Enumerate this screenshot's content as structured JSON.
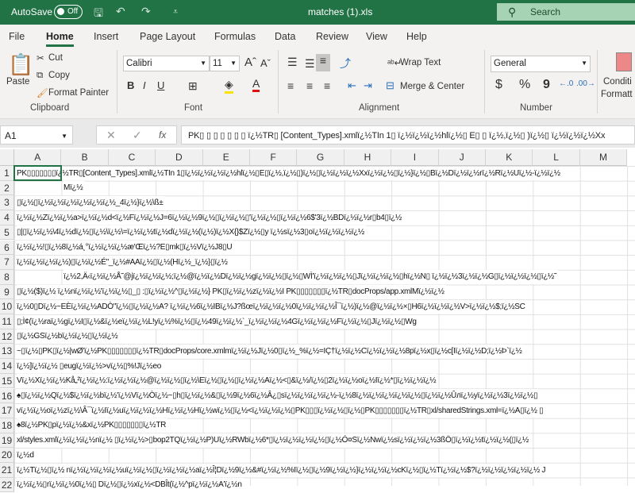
{
  "titlebar": {
    "autosave": "AutoSave",
    "toggle": "Off",
    "filename": "matches (1).xls",
    "search": "Search"
  },
  "tabs": [
    "File",
    "Home",
    "Insert",
    "Page Layout",
    "Formulas",
    "Data",
    "Review",
    "View",
    "Help"
  ],
  "ribbon": {
    "paste": "Paste",
    "cut": "Cut",
    "copy": "Copy",
    "format_painter": "Format Painter",
    "clipboard": "Clipboard",
    "font_name": "Calibri",
    "font_size": "11",
    "bold": "B",
    "italic": "I",
    "underline": "U",
    "font": "Font",
    "wrap_text": "Wrap Text",
    "merge_center": "Merge & Center",
    "alignment": "Alignment",
    "number_format": "General",
    "currency": "$",
    "percent": "%",
    "comma": "9",
    "number": "Number",
    "conditional": "Conditi",
    "formatting": "Formatt"
  },
  "formula_bar": {
    "name_box": "A1",
    "fx": "fx",
    "content": "PK▯ ▯ ▯ ▯ ▯ ▯ ▯ ï¿½TR▯ [Content_Types].xmlï¿½TIn  1▯ ï¿½ï¿½ï¿½hlï¿½▯ E▯ ▯ ï¿½,ï¿½▯ )ï¿½▯ ï¿½ï¿½ï¿½Xx"
  },
  "columns": [
    "A",
    "B",
    "C",
    "D",
    "E",
    "F",
    "G",
    "H",
    "I",
    "J",
    "K",
    "L",
    "M"
  ],
  "rows": [
    {
      "n": "1",
      "text": "PK▯▯▯▯▯▯▯ï¿½TR▯[Content_Types].xmlï¿½TIn  1▯ï¿½ï¿½ï¿½ï¿½hlï¿½▯E▯ï¿½,ï¿½▯)ï¿½▯ï¿½ï¿½ï¿½Xxï¿½ï¿½▯ï¿½}ï¿½▯Bï¿½Dï¿½ï¿½rï¿½Rï¿½Uï¿½-ï¿½ï¿½"
    },
    {
      "n": "2",
      "text": "Mï¿½"
    },
    {
      "n": "3",
      "text": "▯ï¿½▯ï¿½ï¿½ï¿½ï¿½ï¿½ï¿½_4ï¿½}ï¿½\\ß±"
    },
    {
      "n": "4",
      "text": "ï¿½ï¿½Zï¿½ï¿½a>ï¿½ï¿½d<ï¿½Fï¿½ï¿½J=6ï¿½ï¿½9ï¿½▯ï¿½ï¿½▯'ï¿½ï¿½▯ï¿½ï¿½6$'3ï¿½BDï¿½ï¿½r▯b4▯ï¿½"
    },
    {
      "n": "5",
      "text": "▯|▯ï¿½ï¿½\\4ï¿½dï¿½▯ï¿½\\ï¿½\\=ï¿½ï¿½tï¿½dï¿½ï¿½(ï¿½)ï¿½X{}$Zï¿½▯y  ï¿½sï¿½3▯oï¿½ï¿½ï¿½ï¿½"
    },
    {
      "n": "6",
      "text": "ï¿½ï¿½!▯ï¿½8ï¿½á¸°ï¿½ï¿½ï¿½æ'Œï¿½?E▯mk▯ï¿½Vï¿½J8▯U"
    },
    {
      "n": "7",
      "text": "ï¿½ï¿½ï¿½ï¿½)▯ï¿½ï¿½É\"_ï¿½#AAï¿½▯ï¿½(Hï¿½_ï¿½}▯ï¿½"
    },
    {
      "n": "8",
      "text": "ï¿½2,Ä‹ï¿½ï¿½Å˜@jï¿½ï¿½ï¿½;ï¿½@ï¿½ï¿½Dï¿½ï¿½gï¿½ï¿½▯ï¿½▯WÌ'ï¿½ï¿½ï¿½▯Jï¿½ï¿½ï¿½▯hï¿½N▯  ï¿½ï¿½3ï¿½ï¿½G▯ï¿½ï¿½ï¿½▯ï¿½˜"
    },
    {
      "n": "9",
      "text": "▯ï¿½($)ï¿½ ï¿½nï¿½ï¿½'ï¿½ï¿½▯_▯ :▯ï¿½ï¿½^▯ï¿½ï¿½}  PK▯ï¿½ï¿½zï¿½ï¿½I  PK▯▯▯▯▯▯▯ï¿½TR▯docProps/app.xmlMï¿½ï¿½"
    },
    {
      "n": "10",
      "text": "ï¿½0▯Dï¿½~EÈï¿½ï¿½ADÒ\"ï¿½▯ï¿½ï¿½A? ï¿½ï¿½6ï¿½IBï¿½J?ßœï¿½ï¿½ï¿½0ï¿½ï¿½ï¿½Î¯ï¿½)ï¿½@ï¿½ï¿½×▯H6ï¿½ï¿½ï¿½V>ï¿½ï¿½$;ï¿½SC"
    },
    {
      "n": "11",
      "text": "▯;Ì¢(ï¿½raï¿½gï¿½I▯ï¿½&ï¿½eï¿½ï¿½L!yï¿½%ï¿½▯ï¿½49ï¿½ï¿½`_ï¿½ï¿½ï¿½4Gï¿½ï¿½ï¿½Fï¿½ï¿½▯Jï¿½ï¿½▯Wg"
    },
    {
      "n": "12",
      "text": "▯ï¿½GSï¿½bï¿½ï¿½▯ï¿½ï¿½"
    },
    {
      "n": "13",
      "text": "~▯ï¿½▯PK▯ï¿½|wØ'ï¿½PK▯▯▯▯▯▯▯ï¿½TR▯docProps/core.xmlmï¿½ï¿½Jï¿½0▯ï¿½_%ï¿½=IÇ†ï¿½ï¿½Cï¿½ï¿½ï¿½8pï¿½x▯ï¿½c[Iï¿½ï¿½D;ï¿½Þ`ï¿½"
    },
    {
      "n": "14",
      "text": "ï¿½]ï¿½ï¿½ ▯eugï¿½ï¿½>vï¿½▯%!Jï¿½eo"
    },
    {
      "n": "15",
      "text": "Vï¿½Xï¿½ï¿½Kå„²ï¿½ï¿½:ï¿½ï¿½ï¿½@ï¿½ï¿½▯ï¿½\\Eï¿½▯ï¿½▯ï¿½ï¿½Aï¿½<▯&ï¿½/ï¿½▯2ï¿½ï¿½oï¿½Iï¿½*▯ï¿½ï¿½ï¿½"
    },
    {
      "n": "16",
      "text": "♠▯ï¿½ï¿½Qï¿½$ï¿½ï¿½bï¿½'ï¿½Vï¿½Òï¿½~▯h▯ï¿½ï¿½&▯ï¿½9ï¿½6ï¿½Â¿▯sï¿½ï¿½ï¿½ï¿½-ï¿½8ï¿½ï¿½ï¿½ï¿½ï¿½▯ï¿½ï¿½Ûлï¿½yï¿½ï¿½3ï¿½ï¿½▯"
    },
    {
      "n": "17",
      "text": "vï¿½ï¿½oï¿½zï¿½\\Â¯ï¿½Iï¿½uï¿½ï¿½ï¿½Hï¿½ï¿½Hï¿½wï¿½▯ï¿½<ï¿½ï¿½ï¿½▯PK▯▯▯ï¿½ï¿½▯ï¿½▯PK▯▯▯▯▯▯▯ï¿½TR▯xl/sharedStrings.xml=ï¿½A▯ï¿½ ▯"
    },
    {
      "n": "18",
      "text": "♠8ï¿½PK▯pï¿½ï¿½&xï¿½PK▯▯▯▯▯▯▯ï¿½TR"
    },
    {
      "n": "19",
      "text": "xl/styles.xmlï¿½ï¿½ï¿½nï¿½ ▯ï¿½ï¿½>▯bop2TQï¿½ï¿½P)Uï¿½RWbï¿½6*▯ï¿½ï¿½ï¿½ï¿½▯ï¿½Ó¤Sï¿½Nwï¿½sï¿½ï¿½ï¿½3ßÖ▯ï¿½ï¿½tï¿½ï¿½(▯ï¿½"
    },
    {
      "n": "20",
      "text": "ï¿½d"
    },
    {
      "n": "21",
      "text": "ï¿½Tï¿½▯ï¿½ nï¿½ï¿½ï¿½ï¿½uï¿½ï¿½▯ï¿½ï¿½ï¿½aï¿½Î¦Dï¿½9ï¿½&#ï¿½ï¿½%Iï¿½▯ï¿½9ï¿½ï¿½}ï¿½ï¿½ï¿½cKï¿½▯ï¿½Tï¿½ï¿½$?ï¿½ï¿½ï¿½ï¿½ï¿½ J"
    },
    {
      "n": "22",
      "text": "ï¿½ï¿½▯rï¿½ï¿½0ï¿½▯ Dï¿½▯ï¿½xï¿½<DBÎt(ï¿½^pï¿½ï¿½A'ï¿½n"
    }
  ]
}
